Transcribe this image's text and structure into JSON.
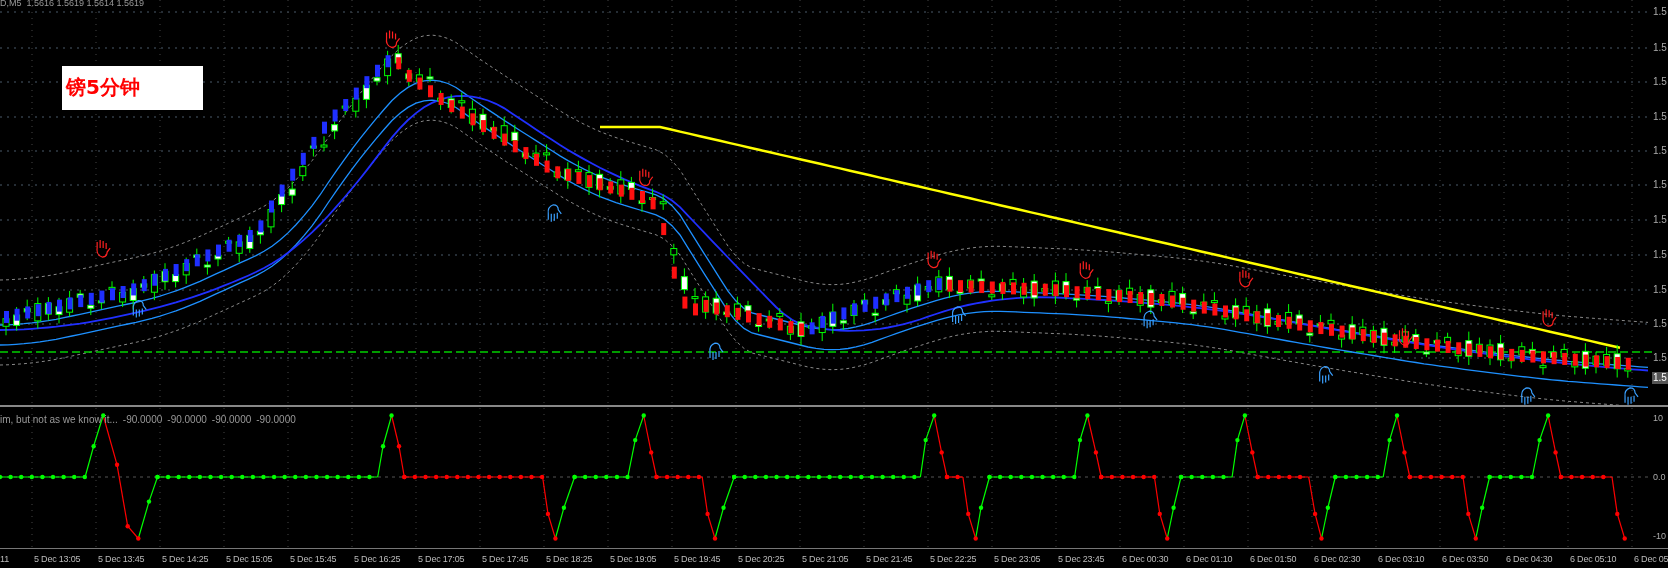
{
  "chart_header": {
    "symbol": "D,M5",
    "quotes": [
      "1.5616",
      "1.5619",
      "1.5614",
      "1.5619"
    ]
  },
  "chart_label": "镑5分钟",
  "price_axis": {
    "labels": [
      "1.5",
      "1.5",
      "1.5",
      "1.5",
      "1.5",
      "1.5",
      "1.5",
      "1.5",
      "1.5",
      "1.5",
      "1.5"
    ],
    "current_price": "1.5"
  },
  "indicator": {
    "name": "im, but not as we know it...",
    "values": [
      "-90.0000",
      "-90.0000",
      "-90.0000",
      "-90.0000"
    ],
    "axis_labels": [
      "10",
      "0.0",
      "-10"
    ]
  },
  "time_axis": [
    "11",
    "5 Dec 13:05",
    "5 Dec 13:45",
    "5 Dec 14:25",
    "5 Dec 15:05",
    "5 Dec 15:45",
    "5 Dec 16:25",
    "5 Dec 17:05",
    "5 Dec 17:45",
    "5 Dec 18:25",
    "5 Dec 19:05",
    "5 Dec 19:45",
    "5 Dec 20:25",
    "5 Dec 21:05",
    "5 Dec 21:45",
    "5 Dec 22:25",
    "5 Dec 23:05",
    "5 Dec 23:45",
    "6 Dec 00:30",
    "6 Dec 01:10",
    "6 Dec 01:50",
    "6 Dec 02:30",
    "6 Dec 03:10",
    "6 Dec 03:50",
    "6 Dec 04:30",
    "6 Dec 05:10",
    "6 Dec 05"
  ]
}
